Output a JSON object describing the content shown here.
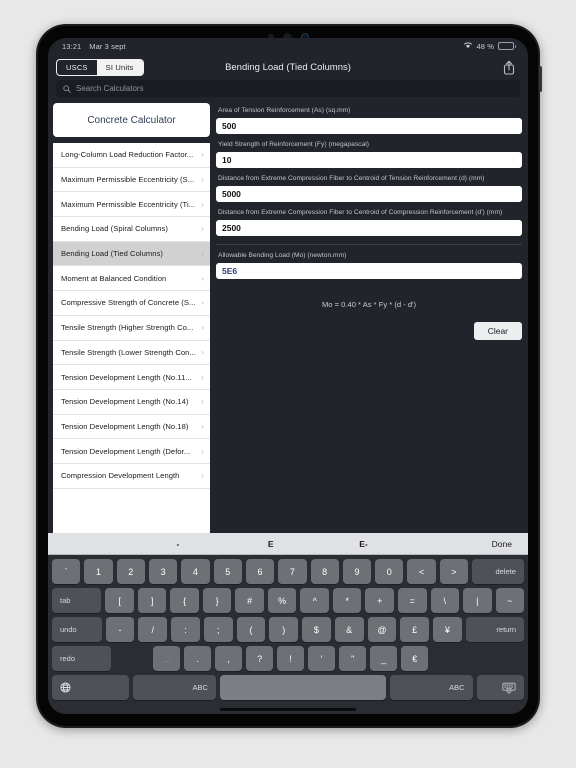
{
  "statusbar": {
    "time": "13:21",
    "date": "Mar 3 sept",
    "battery_percent": "48 %",
    "wifi_icon": "wifi-icon",
    "battery_icon": "battery-icon"
  },
  "navbar": {
    "title": "Bending Load (Tied Columns)",
    "segments": [
      {
        "label": "USCS",
        "selected": false
      },
      {
        "label": "SI Units",
        "selected": true
      }
    ],
    "share_icon": "share-icon"
  },
  "search": {
    "placeholder": "Search Calculators",
    "value": "",
    "icon": "search-icon"
  },
  "sidebar": {
    "header": "Concrete Calculator",
    "items": [
      {
        "label": "Long-Column Load Reduction Factor...",
        "selected": false
      },
      {
        "label": "Maximum Permissible Eccentricity (S...",
        "selected": false
      },
      {
        "label": "Maximum Permissible Eccentricity (Ti...",
        "selected": false
      },
      {
        "label": "Bending Load (Spiral Columns)",
        "selected": false
      },
      {
        "label": "Bending Load (Tied Columns)",
        "selected": true
      },
      {
        "label": "Moment at Balanced Condition",
        "selected": false
      },
      {
        "label": "Compressive Strength of Concrete (S...",
        "selected": false
      },
      {
        "label": "Tensile Strength (Higher Strength Co...",
        "selected": false
      },
      {
        "label": "Tensile Strength (Lower Strength Con...",
        "selected": false
      },
      {
        "label": "Tension Development Length (No.11...",
        "selected": false
      },
      {
        "label": "Tension Development Length (No.14)",
        "selected": false
      },
      {
        "label": "Tension Development Length (No.18)",
        "selected": false
      },
      {
        "label": "Tension Development Length (Defor...",
        "selected": false
      },
      {
        "label": "Compression Development Length",
        "selected": false
      }
    ],
    "chevron_icon": "chevron-right-icon"
  },
  "detail": {
    "fields": [
      {
        "label": "Area of Tension Reinforcement (As) (sq.mm)",
        "value": "500"
      },
      {
        "label": "Yield Strength of Reinforcement (Fy) (megapascal)",
        "value": "10"
      },
      {
        "label": "Distance from Extreme Compression Fiber to Centroid of Tension Reinforcement (d) (mm)",
        "value": "5000"
      },
      {
        "label": "Distance from Extreme Compression Fiber to Centroid of Compression Reinforcement (d') (mm)",
        "value": "2500"
      }
    ],
    "result": {
      "label": "Allowable Bending Load (Mo) (newton.mm)",
      "value": "5E6"
    },
    "formula": "Mo = 0.40 * As * Fy * (d - d')",
    "clear_label": "Clear"
  },
  "keyboard": {
    "toolbar": {
      "minus": "-",
      "e": "E",
      "e_minus": "E-",
      "done": "Done"
    },
    "rows": [
      [
        "`",
        "1",
        "2",
        "3",
        "4",
        "5",
        "6",
        "7",
        "8",
        "9",
        "0",
        "<",
        ">",
        "delete"
      ],
      [
        "tab",
        "[",
        "]",
        "{",
        "}",
        "#",
        "%",
        "^",
        "*",
        "+",
        "=",
        "\\",
        "|",
        "~"
      ],
      [
        "undo",
        "-",
        "/",
        ":",
        ";",
        "(",
        ")",
        "$",
        "&",
        "@",
        "£",
        "¥",
        "return"
      ],
      [
        "redo",
        "...",
        ".",
        ",",
        "?",
        "!",
        "'",
        "\"",
        "_",
        "€"
      ],
      [
        "globe-icon",
        "ABC",
        "space",
        "ABC",
        "keyboard-dismiss-icon"
      ]
    ]
  }
}
